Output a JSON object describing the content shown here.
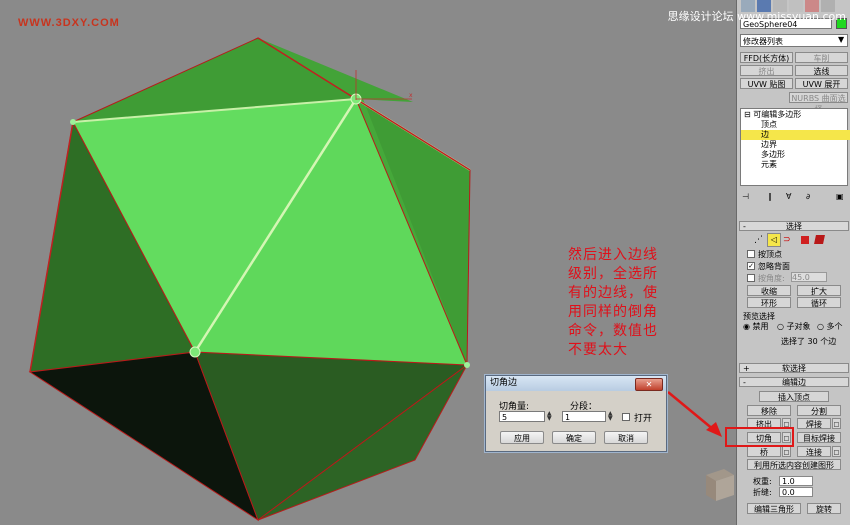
{
  "watermark": "WWW.3DXY.COM",
  "site_watermark": "思缘设计论坛  www.missyuan.com",
  "viewport": {
    "axis_label": "x",
    "note_lines": [
      "然后进入边线",
      "级别，全选所",
      "有的边线，使",
      "用同样的倒角",
      "命令，数值也",
      "不要太大"
    ]
  },
  "dialog": {
    "title": "切角边",
    "close_label": "✕",
    "amount_label": "切角量:",
    "amount_value": "5",
    "segments_label": "分段：",
    "segments_value": "1",
    "open_label": "打开",
    "open_checked": false,
    "apply_label": "应用",
    "ok_label": "确定",
    "cancel_label": "取消"
  },
  "panel": {
    "object_name": "GeoSphere04",
    "object_color": "#1fd81f",
    "modifier_list": "修改器列表",
    "modifier_buttons": [
      {
        "label": "FFD(长方体)",
        "disabled": false
      },
      {
        "label": "车削",
        "disabled": true
      },
      {
        "label": "挤出",
        "disabled": true
      },
      {
        "label": "选线",
        "disabled": false
      },
      {
        "label": "UVW 贴图",
        "disabled": false
      },
      {
        "label": "UVW 展开",
        "disabled": false
      },
      {
        "label": "NURBS 曲面选择",
        "disabled": true
      }
    ],
    "stack": {
      "root": "可编辑多边形",
      "items": [
        "顶点",
        "边",
        "边界",
        "多边形",
        "元素"
      ],
      "selected": "边"
    },
    "selection": {
      "title": "选择",
      "by_vertex": "按顶点",
      "ignore_backfacing": "忽略背面",
      "ignore_checked": true,
      "by_angle": "按角度:",
      "angle_value": "45.0",
      "shrink": "收缩",
      "grow": "扩大",
      "ring": "环形",
      "loop": "循环",
      "preview_title": "预览选择",
      "preview_options": [
        "禁用",
        "子对象",
        "多个"
      ],
      "preview_selected": "禁用",
      "status": "选择了 30 个边"
    },
    "soft_selection": "软选择",
    "edit_edges": {
      "title": "编辑边",
      "insert_vertex": "插入顶点",
      "remove": "移除",
      "split": "分割",
      "extrude": "挤出",
      "weld": "焊接",
      "chamfer": "切角",
      "target_weld": "目标焊接",
      "bridge": "桥",
      "connect": "连接",
      "create_shape": "利用所选内容创建图形",
      "weight_label": "权重:",
      "weight_value": "1.0",
      "crease_label": "折缝:",
      "crease_value": "0.0",
      "edit_tri": "编辑三角形",
      "rotate": "旋转"
    }
  }
}
